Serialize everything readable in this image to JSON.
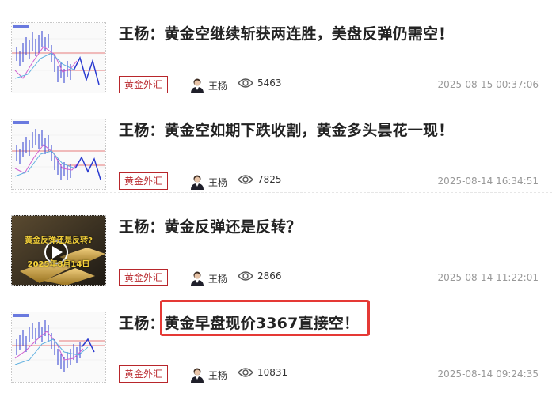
{
  "articles": [
    {
      "title": "王杨：黄金空继续斩获两连胜，美盘反弹仍需空！",
      "tag": "黄金外汇",
      "author": "王杨",
      "views": "5463",
      "date": "2025-08-15 00:37:06",
      "thumbnail": "chart-thumbnail"
    },
    {
      "title": "王杨：黄金空如期下跌收割，黄金多头昙花一现！",
      "tag": "黄金外汇",
      "author": "王杨",
      "views": "7825",
      "date": "2025-08-14 16:34:51",
      "thumbnail": "chart-thumbnail"
    },
    {
      "title": "王杨：黄金反弹还是反转？",
      "tag": "黄金外汇",
      "author": "王杨",
      "views": "2866",
      "date": "2025-08-14 11:22:01",
      "thumbnail": "video-thumbnail",
      "thumb_caption_1": "黄金反弹还是反转?",
      "thumb_caption_2": "2025年8月14日"
    },
    {
      "title_prefix": "王杨：",
      "title_main": "黄金早盘现价3367直接空！",
      "tag": "黄金外汇",
      "author": "王杨",
      "views": "10831",
      "date": "2025-08-14 09:24:35",
      "thumbnail": "chart-thumbnail",
      "highlight_color": "#e53935"
    }
  ],
  "colors": {
    "tag": "#b8262b",
    "title": "#222222",
    "date": "#999999"
  }
}
